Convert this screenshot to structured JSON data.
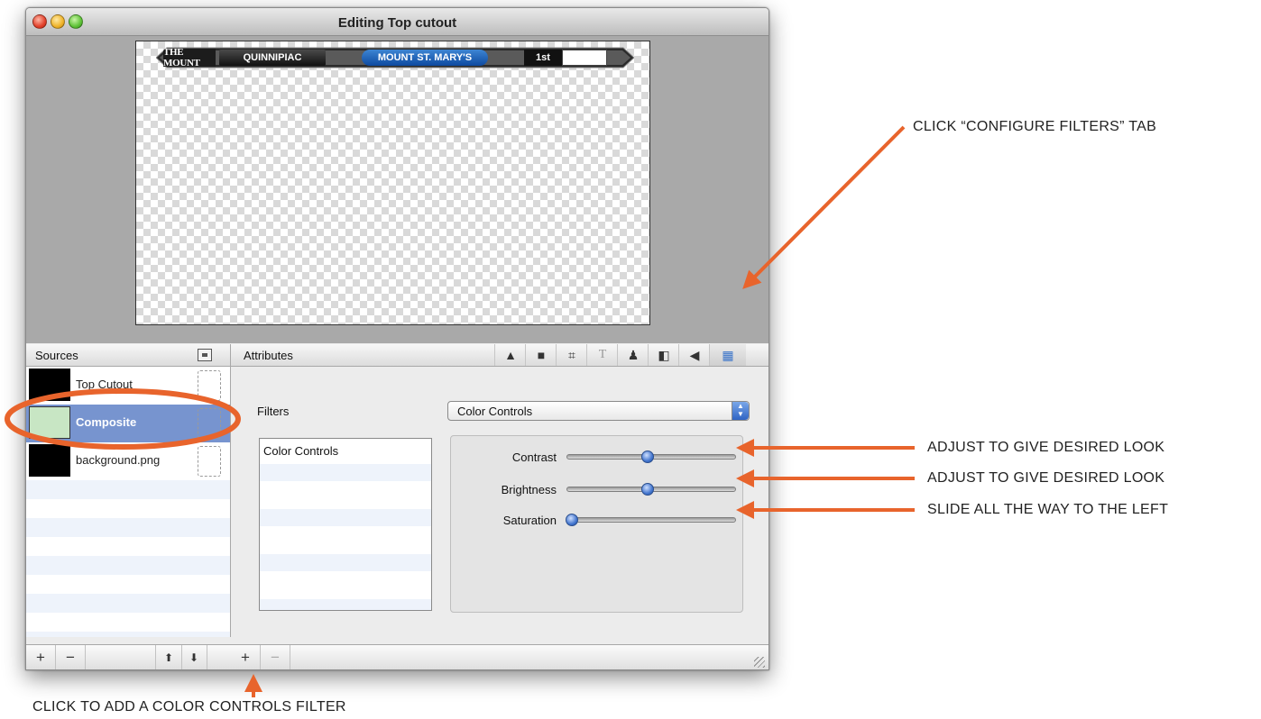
{
  "window": {
    "title": "Editing Top cutout"
  },
  "canvas": {
    "scorebug": {
      "logo_text": "THE MOUNT",
      "team_left": "QUINNIPIAC",
      "team_right": "MOUNT ST. MARY'S",
      "period": "1st"
    }
  },
  "sources": {
    "header": "Sources",
    "items": [
      {
        "label": "Top Cutout",
        "selected": false
      },
      {
        "label": "Composite",
        "selected": true
      },
      {
        "label": "background.png",
        "selected": false
      }
    ],
    "footer": {
      "add": "+",
      "remove": "−",
      "up": "⬆",
      "down": "⬇"
    }
  },
  "attributes": {
    "header": "Attributes",
    "tabs": [
      {
        "icon": "shapes-icon",
        "glyph": "▲"
      },
      {
        "icon": "folder-icon",
        "glyph": "■"
      },
      {
        "icon": "crop-icon",
        "glyph": "⌗"
      },
      {
        "icon": "text-icon",
        "glyph": "T"
      },
      {
        "icon": "person-icon",
        "glyph": "♟"
      },
      {
        "icon": "split-icon",
        "glyph": "◧"
      },
      {
        "icon": "audio-icon",
        "glyph": "◀"
      },
      {
        "icon": "filters-icon",
        "glyph": "▦",
        "active": true
      }
    ],
    "filters_label": "Filters",
    "filter_select_value": "Color Controls",
    "filter_list": [
      "Color Controls"
    ],
    "controls": [
      {
        "label": "Contrast",
        "value": 0.5
      },
      {
        "label": "Brightness",
        "value": 0.5
      },
      {
        "label": "Saturation",
        "value": 0.0
      }
    ],
    "footer": {
      "add": "+",
      "remove": "−"
    }
  },
  "annotations": {
    "configure_tab": "CLICK “CONFIGURE FILTERS” TAB",
    "contrast_note": "ADJUST TO GIVE DESIRED LOOK",
    "brightness_note": "ADJUST TO GIVE DESIRED LOOK",
    "saturation_note": "SLIDE ALL THE WAY TO THE LEFT",
    "add_filter_note": "CLICK TO ADD A COLOR CONTROLS FILTER",
    "accent_color": "#e8642c"
  }
}
